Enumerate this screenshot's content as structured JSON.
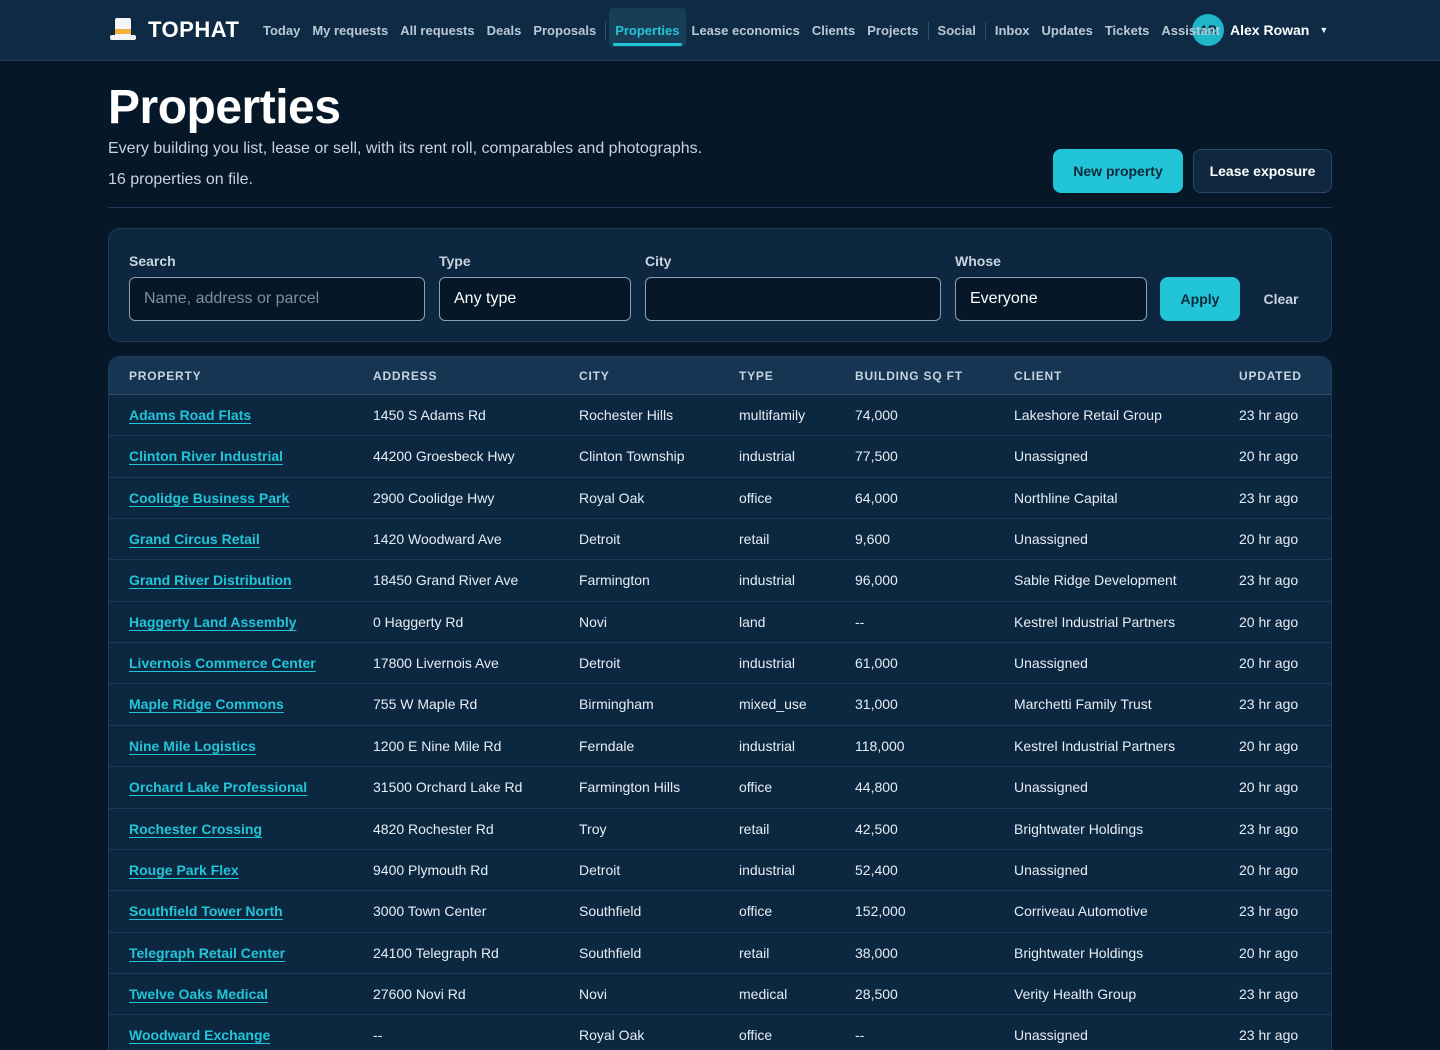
{
  "app": {
    "name": "TOPHAT"
  },
  "nav": {
    "items": [
      "Today",
      "My requests",
      "All requests",
      "Deals",
      "Proposals",
      "Properties",
      "Lease economics",
      "Clients",
      "Projects",
      "Social",
      "Inbox",
      "Updates",
      "Tickets",
      "Assistant"
    ],
    "active": "Properties"
  },
  "user": {
    "initials": "AR",
    "name": "Alex Rowan"
  },
  "header": {
    "title": "Properties",
    "subtitle": "Every building you list, lease or sell, with its rent roll, comparables and photographs.",
    "count": "16 properties on file.",
    "new_button": "New property",
    "exposure_button": "Lease exposure"
  },
  "filters": {
    "search_label": "Search",
    "search_placeholder": "Name, address or parcel",
    "search_value": "",
    "type_label": "Type",
    "type_value": "Any type",
    "city_label": "City",
    "city_value": "",
    "whose_label": "Whose",
    "whose_value": "Everyone",
    "apply": "Apply",
    "clear": "Clear"
  },
  "colors": {
    "accent": "#22c5d8",
    "background": "#061727",
    "surface": "#0e2740"
  },
  "table": {
    "columns": [
      "PROPERTY",
      "ADDRESS",
      "CITY",
      "TYPE",
      "BUILDING SQ FT",
      "CLIENT",
      "UPDATED"
    ],
    "rows": [
      [
        "Adams Road Flats",
        "1450 S Adams Rd",
        "Rochester Hills",
        "multifamily",
        "74,000",
        "Lakeshore Retail Group",
        "23 hr ago"
      ],
      [
        "Clinton River Industrial",
        "44200 Groesbeck Hwy",
        "Clinton Township",
        "industrial",
        "77,500",
        "Unassigned",
        "20 hr ago"
      ],
      [
        "Coolidge Business Park",
        "2900 Coolidge Hwy",
        "Royal Oak",
        "office",
        "64,000",
        "Northline Capital",
        "23 hr ago"
      ],
      [
        "Grand Circus Retail",
        "1420 Woodward Ave",
        "Detroit",
        "retail",
        "9,600",
        "Unassigned",
        "20 hr ago"
      ],
      [
        "Grand River Distribution",
        "18450 Grand River Ave",
        "Farmington",
        "industrial",
        "96,000",
        "Sable Ridge Development",
        "23 hr ago"
      ],
      [
        "Haggerty Land Assembly",
        "0 Haggerty Rd",
        "Novi",
        "land",
        "--",
        "Kestrel Industrial Partners",
        "20 hr ago"
      ],
      [
        "Livernois Commerce Center",
        "17800 Livernois Ave",
        "Detroit",
        "industrial",
        "61,000",
        "Unassigned",
        "20 hr ago"
      ],
      [
        "Maple Ridge Commons",
        "755 W Maple Rd",
        "Birmingham",
        "mixed_use",
        "31,000",
        "Marchetti Family Trust",
        "23 hr ago"
      ],
      [
        "Nine Mile Logistics",
        "1200 E Nine Mile Rd",
        "Ferndale",
        "industrial",
        "118,000",
        "Kestrel Industrial Partners",
        "20 hr ago"
      ],
      [
        "Orchard Lake Professional",
        "31500 Orchard Lake Rd",
        "Farmington Hills",
        "office",
        "44,800",
        "Unassigned",
        "20 hr ago"
      ],
      [
        "Rochester Crossing",
        "4820 Rochester Rd",
        "Troy",
        "retail",
        "42,500",
        "Brightwater Holdings",
        "23 hr ago"
      ],
      [
        "Rouge Park Flex",
        "9400 Plymouth Rd",
        "Detroit",
        "industrial",
        "52,400",
        "Unassigned",
        "20 hr ago"
      ],
      [
        "Southfield Tower North",
        "3000 Town Center",
        "Southfield",
        "office",
        "152,000",
        "Corriveau Automotive",
        "23 hr ago"
      ],
      [
        "Telegraph Retail Center",
        "24100 Telegraph Rd",
        "Southfield",
        "retail",
        "38,000",
        "Brightwater Holdings",
        "20 hr ago"
      ],
      [
        "Twelve Oaks Medical",
        "27600 Novi Rd",
        "Novi",
        "medical",
        "28,500",
        "Verity Health Group",
        "23 hr ago"
      ],
      [
        "Woodward Exchange",
        "--",
        "Royal Oak",
        "office",
        "--",
        "Unassigned",
        "23 hr ago"
      ]
    ]
  }
}
